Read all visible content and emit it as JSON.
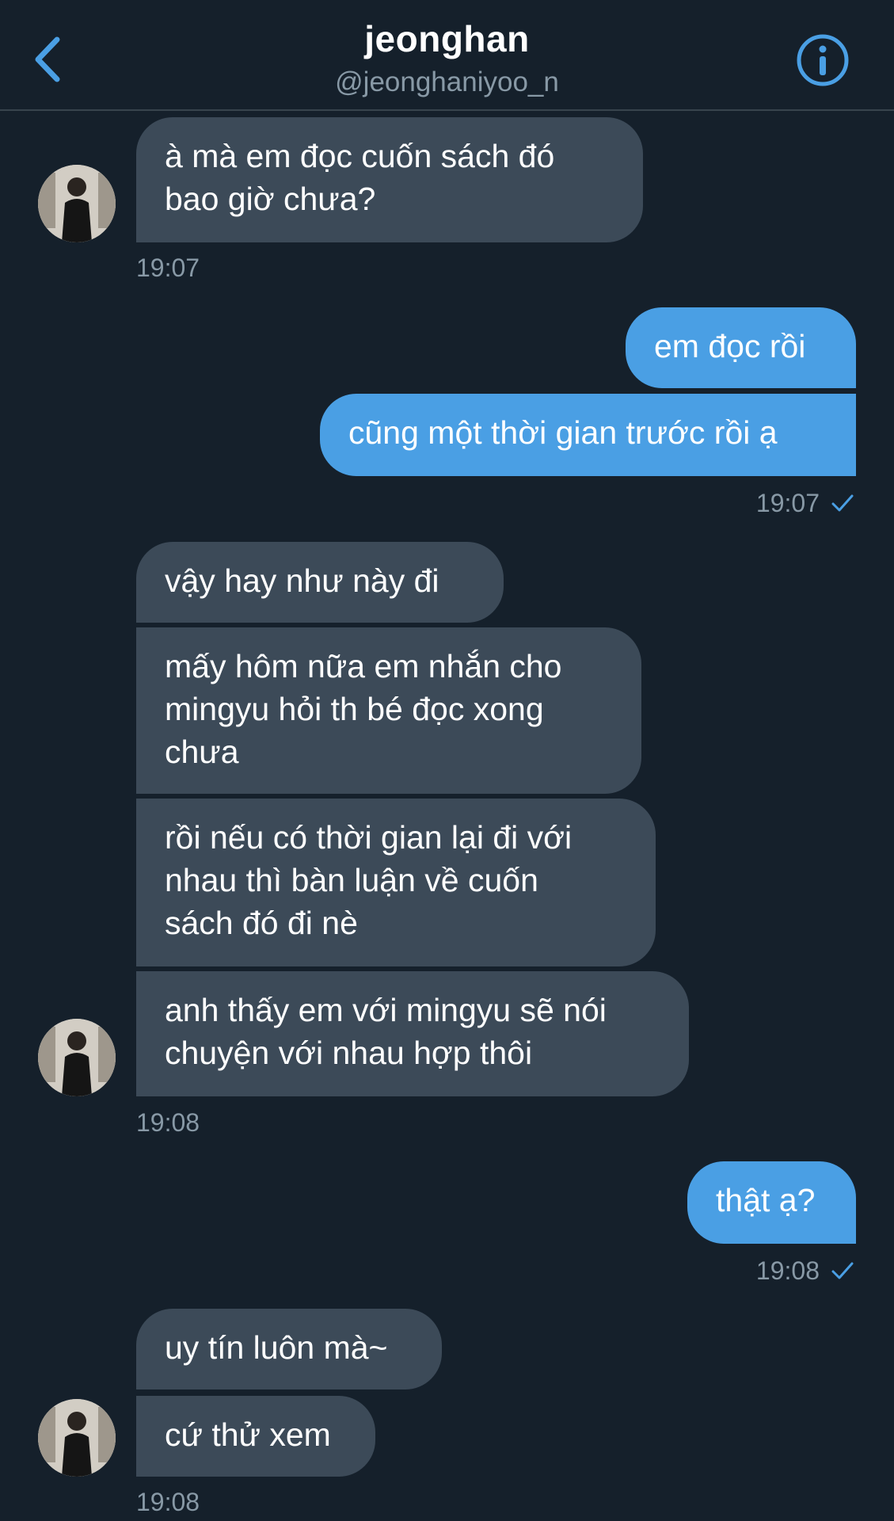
{
  "header": {
    "title": "jeonghan",
    "handle": "@jeonghaniyoo_n",
    "back_icon": "chevron-left-icon",
    "info_icon": "info-icon"
  },
  "colors": {
    "background": "#15202b",
    "incoming_bubble": "#3c4a58",
    "outgoing_bubble": "#4a9fe4",
    "accent": "#4a9fe4",
    "muted_text": "#8899a6"
  },
  "messages": [
    {
      "direction": "in",
      "lines": [
        "à mà em đọc cuốn sách đó",
        "bao giờ chưa?"
      ]
    },
    {
      "direction": "in",
      "time": "19:07"
    },
    {
      "direction": "out",
      "lines": [
        "em đọc rồi"
      ]
    },
    {
      "direction": "out",
      "lines": [
        "cũng một thời gian trước rồi ạ"
      ]
    },
    {
      "direction": "out",
      "time": "19:07",
      "status_icon": "check-icon"
    },
    {
      "direction": "in",
      "lines": [
        "vậy hay như này đi"
      ]
    },
    {
      "direction": "in",
      "lines": [
        "mấy hôm nữa em nhắn cho",
        "mingyu hỏi th bé đọc xong",
        "chưa"
      ]
    },
    {
      "direction": "in",
      "lines": [
        "rồi nếu có thời gian lại đi với",
        "nhau thì bàn luận về cuốn",
        "sách đó đi nè"
      ]
    },
    {
      "direction": "in",
      "lines": [
        "anh thấy em với mingyu sẽ nói",
        "chuyện với nhau hợp thôi"
      ]
    },
    {
      "direction": "in",
      "time": "19:08"
    },
    {
      "direction": "out",
      "lines": [
        "thật ạ?"
      ]
    },
    {
      "direction": "out",
      "time": "19:08",
      "status_icon": "check-icon"
    },
    {
      "direction": "in",
      "lines": [
        "uy tín luôn mà~"
      ]
    },
    {
      "direction": "in",
      "lines": [
        "cứ thử xem"
      ]
    },
    {
      "direction": "in",
      "time": "19:08"
    }
  ]
}
